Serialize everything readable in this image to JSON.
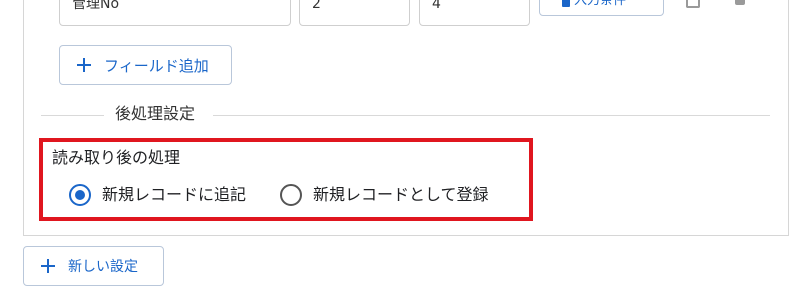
{
  "fields_row": {
    "name_value": "管理No",
    "start_value": "2",
    "length_value": "4",
    "condition_button_label": "入力条件"
  },
  "add_field_button_label": "フィールド追加",
  "post_processing": {
    "section_title": "後処理設定",
    "label": "読み取り後の処理",
    "options": [
      {
        "label": "新規レコードに追記",
        "selected": true
      },
      {
        "label": "新規レコードとして登録",
        "selected": false
      }
    ]
  },
  "new_setting_button_label": "新しい設定",
  "colors": {
    "accent": "#1a66c9",
    "highlight": "#e0161f"
  }
}
